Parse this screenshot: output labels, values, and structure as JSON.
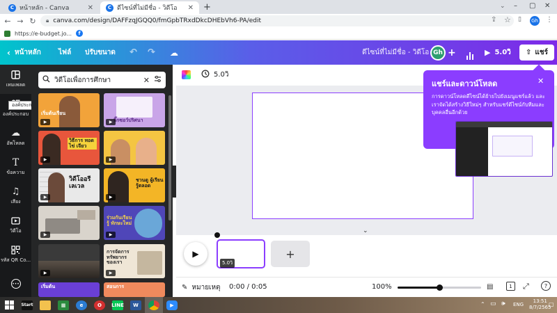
{
  "browser": {
    "tabs": [
      {
        "label": "หน้าหลัก - Canva",
        "active": false
      },
      {
        "label": "ดีไซน์ที่ไม่มีชื่อ - วิดีโอ",
        "active": true
      }
    ],
    "new_tab": "+",
    "url": "canva.com/design/DAFFzqJGQQ0/fmGpbTRxdDkcDHEbVh6-PA/edit",
    "profile": "Gh",
    "bookmarks": [
      {
        "label": "https://e-budget.jo..."
      }
    ]
  },
  "header": {
    "home": "หน้าหลัก",
    "file": "ไฟล์",
    "resize": "ปรับขนาด",
    "design_title": "ดีไซน์ที่ไม่มีชื่อ - วิดีโอ",
    "avatar": "Gh",
    "duration": "5.0วิ",
    "share": "แชร์"
  },
  "rail": {
    "items": [
      {
        "label": "เทมเพลต",
        "icon": "template-icon"
      },
      {
        "label": "องค์ประกอบ",
        "icon": "elements-icon"
      },
      {
        "label": "อัพโหลด",
        "icon": "upload-icon"
      },
      {
        "label": "ข้อความ",
        "icon": "text-icon"
      },
      {
        "label": "เสียง",
        "icon": "music-icon"
      },
      {
        "label": "วิดีโอ",
        "icon": "video-icon"
      },
      {
        "label": "รหัส QR Co...",
        "icon": "qr-icon"
      },
      {
        "label": "",
        "icon": "apps-icon"
      }
    ],
    "tooltip": "องค์ประกอบ"
  },
  "panel": {
    "search_value": "วิดีโอเพื่อการศึกษา",
    "thumbnails": [
      {
        "text": "เริ่มต้นเรียน",
        "color": "#f2a33a"
      },
      {
        "text": "จิ๊กซอว์ปริศนา",
        "color": "#c9a5e8"
      },
      {
        "text": "วิธีการ ทอดไข่ เจียว",
        "color": "#e8563c"
      },
      {
        "text": "",
        "color": "#f4c542"
      },
      {
        "text": "วิดีโออรี เลเวล",
        "color": "#e9e9e9"
      },
      {
        "text": "ชวนดู ผู้เรียนรู้ตลอด",
        "color": "#f3b526"
      },
      {
        "text": "",
        "color": "#d9d4cc"
      },
      {
        "text": "ร่วมกันเรียนรู้ ทักษะใหม่",
        "color": "#4f46b8"
      },
      {
        "text": "",
        "color": "#3a3a3a"
      },
      {
        "text": "การจัดการ ทรัพยากร ของเรา",
        "color": "#efe6d6"
      },
      {
        "text": "เริ่มต้น",
        "color": "#6a3fd6"
      },
      {
        "text": "สอนการ",
        "color": "#f08a5d"
      }
    ]
  },
  "editor": {
    "duration_label": "5.0วิ",
    "clip_duration": "5.0วิ",
    "notes": "หมายเหตุ",
    "time": "0:00 / 0:05",
    "zoom": "100%",
    "zoom_level": 0.5,
    "page_count": "1"
  },
  "popover": {
    "title": "แชร์และดาวน์โหลด",
    "body": "การดาวน์โหลดดีไซน์ได้ย้ายไปยังเมนูแชร์แล้ว และเราจัดได้สร้างวิธีใหม่ๆ สำหรับแชร์ดีไซน์กับทีมและบุคคลอื่นอีกด้วย"
  },
  "taskbar": {
    "start_tile": "Start",
    "time": "13:51",
    "date": "8/7/2565",
    "lang": "ENG"
  },
  "colors": {
    "accent": "#8b3dff",
    "rail_bg": "#18191b",
    "panel_bg": "#252627"
  }
}
